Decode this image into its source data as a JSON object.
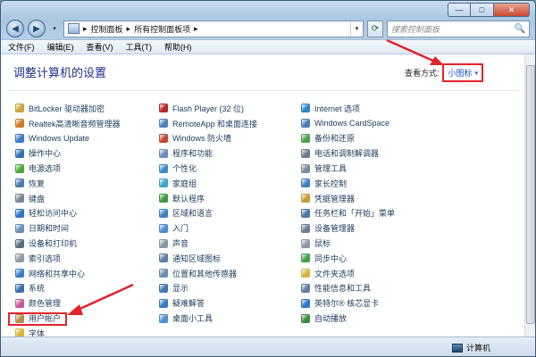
{
  "window": {
    "controls": {
      "minimize": "—",
      "maximize": "□",
      "close": "✕"
    }
  },
  "navbar": {
    "back": "◀",
    "forward": "▶",
    "history": "▾",
    "breadcrumb": [
      "控制面板",
      "所有控制面板项"
    ],
    "breadcrumb_sep": "▸",
    "address_dropdown": "▾",
    "refresh": "⟳",
    "search_placeholder": "搜索控制面板",
    "search_icon": "🔍"
  },
  "menubar": {
    "items": [
      "文件(F)",
      "编辑(E)",
      "查看(V)",
      "工具(T)",
      "帮助(H)"
    ]
  },
  "content": {
    "heading": "调整计算机的设置",
    "view_by_label": "查看方式:",
    "view_by_value": "小图标",
    "view_by_caret": "▾",
    "columns": [
      [
        {
          "label": "BitLocker 驱动器加密",
          "icon": "bitlocker-icon",
          "color": "#c9a33b"
        },
        {
          "label": "Realtek高清晰音频管理器",
          "icon": "audio-icon",
          "color": "#d27a2c"
        },
        {
          "label": "Windows Update",
          "icon": "windows-update-icon",
          "color": "#3a7ac8"
        },
        {
          "label": "操作中心",
          "icon": "action-center-icon",
          "color": "#2d6fb8"
        },
        {
          "label": "电源选项",
          "icon": "power-icon",
          "color": "#4caa3a"
        },
        {
          "label": "恢复",
          "icon": "recovery-icon",
          "color": "#4f79ad"
        },
        {
          "label": "键盘",
          "icon": "keyboard-icon",
          "color": "#7a8594"
        },
        {
          "label": "轻松访问中心",
          "icon": "ease-access-icon",
          "color": "#2d74c4"
        },
        {
          "label": "日期和时间",
          "icon": "clock-icon",
          "color": "#6b8fb5"
        },
        {
          "label": "设备和打印机",
          "icon": "printer-icon",
          "color": "#5a6b7e"
        },
        {
          "label": "索引选项",
          "icon": "index-icon",
          "color": "#8f98a5"
        },
        {
          "label": "网络和共享中心",
          "icon": "network-icon",
          "color": "#3b7fc1"
        },
        {
          "label": "系统",
          "icon": "system-icon",
          "color": "#3a6ea8"
        },
        {
          "label": "颜色管理",
          "icon": "color-icon",
          "color": "#c65a9b"
        },
        {
          "label": "用户帐户",
          "icon": "user-accounts-icon",
          "color": "#b88d4a"
        },
        {
          "label": "字体",
          "icon": "font-icon",
          "color": "#d9b441"
        }
      ],
      [
        {
          "label": "Flash Player (32 位)",
          "icon": "flash-icon",
          "color": "#b8262a"
        },
        {
          "label": "RemoteApp 和桌面连接",
          "icon": "remoteapp-icon",
          "color": "#4e82b9"
        },
        {
          "label": "Windows 防火墙",
          "icon": "firewall-icon",
          "color": "#c2442f"
        },
        {
          "label": "程序和功能",
          "icon": "programs-icon",
          "color": "#6b8dbb"
        },
        {
          "label": "个性化",
          "icon": "personalize-icon",
          "color": "#3f8acb"
        },
        {
          "label": "家庭组",
          "icon": "homegroup-icon",
          "color": "#3fa3c8"
        },
        {
          "label": "默认程序",
          "icon": "default-programs-icon",
          "color": "#3a9a3a"
        },
        {
          "label": "区域和语言",
          "icon": "region-icon",
          "color": "#3b82c4"
        },
        {
          "label": "入门",
          "icon": "getting-started-icon",
          "color": "#4a8acc"
        },
        {
          "label": "声音",
          "icon": "sound-icon",
          "color": "#8b95a3"
        },
        {
          "label": "通知区域图标",
          "icon": "notification-icon",
          "color": "#5c7fa6"
        },
        {
          "label": "位置和其他传感器",
          "icon": "sensor-icon",
          "color": "#6a8eb0"
        },
        {
          "label": "显示",
          "icon": "display-icon",
          "color": "#3e74b0"
        },
        {
          "label": "疑难解答",
          "icon": "troubleshoot-icon",
          "color": "#3a79bf"
        },
        {
          "label": "桌面小工具",
          "icon": "gadgets-icon",
          "color": "#4c8fc9"
        }
      ],
      [
        {
          "label": "Internet 选项",
          "icon": "internet-icon",
          "color": "#2f86c9"
        },
        {
          "label": "Windows CardSpace",
          "icon": "cardspace-icon",
          "color": "#4a7fba"
        },
        {
          "label": "备份和还原",
          "icon": "backup-icon",
          "color": "#4aa04a"
        },
        {
          "label": "电话和调制解调器",
          "icon": "phone-icon",
          "color": "#6b7c8f"
        },
        {
          "label": "管理工具",
          "icon": "admin-tools-icon",
          "color": "#7a8ca0"
        },
        {
          "label": "家长控制",
          "icon": "parental-icon",
          "color": "#3f7fc0"
        },
        {
          "label": "凭据管理器",
          "icon": "credential-icon",
          "color": "#c79b3c"
        },
        {
          "label": "任务栏和「开始」菜单",
          "icon": "taskbar-icon",
          "color": "#4a76a8"
        },
        {
          "label": "设备管理器",
          "icon": "device-manager-icon",
          "color": "#6a7f95"
        },
        {
          "label": "鼠标",
          "icon": "mouse-icon",
          "color": "#8e98a4"
        },
        {
          "label": "同步中心",
          "icon": "sync-icon",
          "color": "#3ea14a"
        },
        {
          "label": "文件夹选项",
          "icon": "folder-options-icon",
          "color": "#d8b443"
        },
        {
          "label": "性能信息和工具",
          "icon": "performance-icon",
          "color": "#5d7fa2"
        },
        {
          "label": "英特尔® 核芯显卡",
          "icon": "intel-icon",
          "color": "#2f76c4"
        },
        {
          "label": "自动播放",
          "icon": "autoplay-icon",
          "color": "#3c8a3c"
        }
      ]
    ]
  },
  "status": {
    "computer": "计算机"
  },
  "colors": {
    "highlight": "#e2232a",
    "link": "#1e395b",
    "heading": "#1e3287"
  }
}
